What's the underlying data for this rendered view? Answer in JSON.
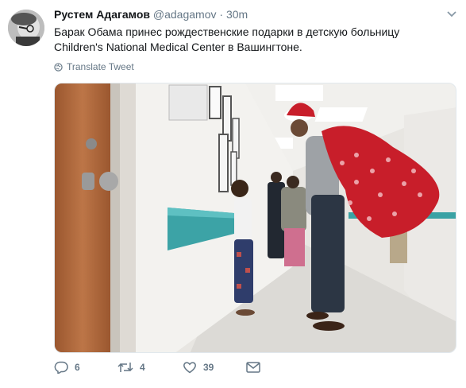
{
  "tweet": {
    "author_name": "Рустем Адагамов",
    "author_handle": "@adagamov",
    "separator": "·",
    "time": "30m",
    "text_line1": "Барак Обама принес рождественские подарки в детскую больницу",
    "text_line2": "Children's National Medical Center в Вашингтоне.",
    "translate_label": "Translate Tweet"
  },
  "actions": {
    "reply_count": "6",
    "retweet_count": "4",
    "like_count": "39"
  },
  "icons": {
    "reply": "reply-icon",
    "retweet": "retweet-icon",
    "like": "heart-icon",
    "message": "envelope-icon",
    "translate": "globe-icon",
    "menu": "chevron-down-icon"
  },
  "colors": {
    "text": "#14171a",
    "secondary": "#657786",
    "border": "#e1e8ed",
    "santa_bag": "#c81e2a"
  }
}
